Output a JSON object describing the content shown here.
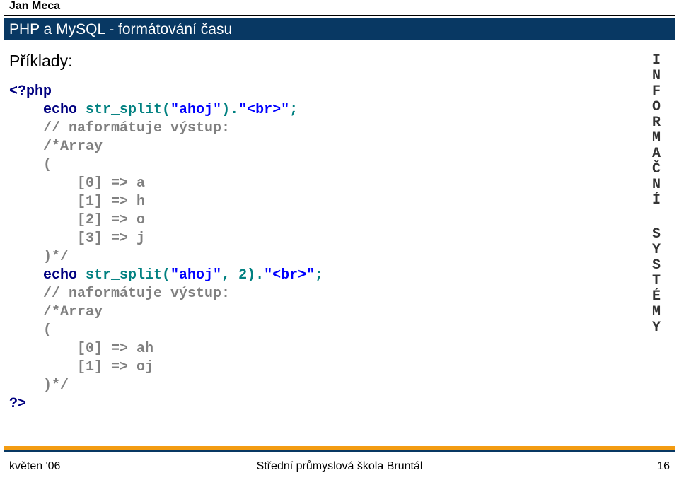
{
  "author": "Jan Meca",
  "title": "PHP a MySQL - formátování času",
  "heading": "Příklady:",
  "code": {
    "l1": "<?php",
    "l2a": "    echo",
    "l2b": " str_split(",
    "l2c": "\"ahoj\"",
    "l2d": ").",
    "l2e": "\"<br>\"",
    "l2f": ";",
    "l3": "    // naformátuje výstup:",
    "l4": "    /*Array",
    "l5": "    (",
    "l6": "        [0] => a",
    "l7": "        [1] => h",
    "l8": "        [2] => o",
    "l9": "        [3] => j",
    "l10": "    )*/",
    "l11a": "    echo",
    "l11b": " str_split(",
    "l11c": "\"ahoj\"",
    "l11d": ", 2).",
    "l11e": "\"<br>\"",
    "l11f": ";",
    "l12": "    // naformátuje výstup:",
    "l13": "    /*Array",
    "l14": "    (",
    "l15": "        [0] => ah",
    "l16": "        [1] => oj",
    "l17": "    )*/",
    "l18": "?>"
  },
  "sidebar": [
    "I",
    "N",
    "F",
    "O",
    "R",
    "M",
    "A",
    "Č",
    "N",
    "Í",
    "",
    "S",
    "Y",
    "S",
    "T",
    "É",
    "M",
    "Y"
  ],
  "footer": {
    "left": "květen '06",
    "center": "Střední průmyslová škola Bruntál",
    "right": "16"
  }
}
